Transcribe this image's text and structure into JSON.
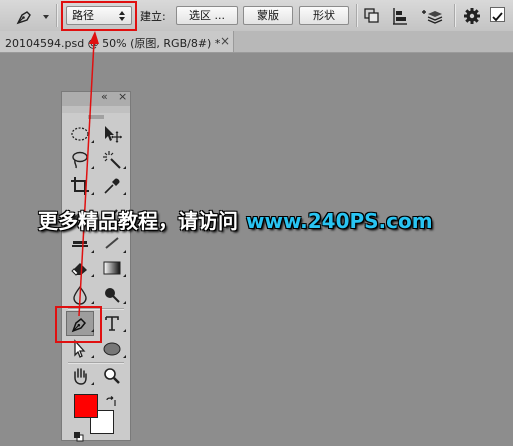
{
  "options_bar": {
    "mode_select": "路径",
    "make_label": "建立:",
    "selection_button": "选区 ...",
    "mask_button": "蒙版",
    "shape_button": "形状"
  },
  "document_tab": {
    "title": "20104594.psd @ 50% (原图, RGB/8#) *",
    "close": "×"
  },
  "tools_panel": {
    "collapse": "«",
    "close": "×"
  },
  "colors": {
    "foreground": "#ff0000",
    "background": "#ffffff",
    "annotation": "#e01010"
  },
  "watermark": {
    "cn": "更多精品教程，请访问",
    "url": "www.240PS.com"
  }
}
